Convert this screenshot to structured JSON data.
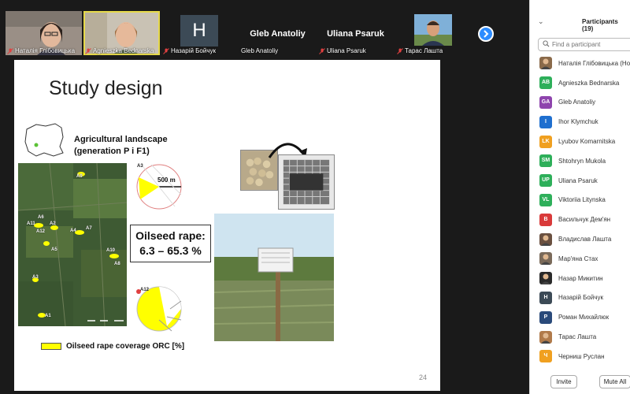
{
  "video_strip": {
    "tiles": [
      {
        "name": "Наталія Глібовицька",
        "muted": true
      },
      {
        "name": "Agnieszka Bednarska",
        "muted": true
      },
      {
        "name": "Назарій Бойчук",
        "muted": true,
        "initial": "H"
      },
      {
        "name": "Gleb Anatoliy",
        "muted": false,
        "label": "Gleb Anatoliy"
      },
      {
        "name": "Uliana Psaruk",
        "muted": true,
        "label": "Uliana Psaruk"
      },
      {
        "name": "Тарас Лашта",
        "muted": true
      }
    ]
  },
  "slide": {
    "title": "Study design",
    "landscape_label_line1": "Agricultural landscape",
    "landscape_label_line2": "(generation P i F1)",
    "oilseed_line1": "Oilseed rape:",
    "oilseed_line2": "6.3 – 65.3 %",
    "scale": "500 m",
    "legend": "Oilseed rape coverage ORC [%]",
    "page_number": "24",
    "site_labels": [
      "A9",
      "A3",
      "A6",
      "A11",
      "A12",
      "A2",
      "A4",
      "A7",
      "A5",
      "A10",
      "A8",
      "A3",
      "A1",
      "A12"
    ],
    "colors": {
      "oilseed": "#ffff00",
      "map_dark": "#3e5a33"
    }
  },
  "participants": {
    "title": "Participants (19)",
    "search_placeholder": "Find a participant",
    "list": [
      {
        "initials": "",
        "name": "Наталія Глібовицька (Host",
        "color": "#8a6a4a",
        "photo": true
      },
      {
        "initials": "AB",
        "name": "Agnieszka Bednarska",
        "color": "#2eaf5a"
      },
      {
        "initials": "GA",
        "name": "Gleb Anatoliy",
        "color": "#8e44ad"
      },
      {
        "initials": "I",
        "name": "Ihor Klymchuk",
        "color": "#1f6fcf"
      },
      {
        "initials": "LK",
        "name": "Lyubov Komarnitska",
        "color": "#f0a020"
      },
      {
        "initials": "SM",
        "name": "Shtohryn Mukola",
        "color": "#2eaf5a"
      },
      {
        "initials": "UP",
        "name": "Uliana Psaruk",
        "color": "#2eaf5a"
      },
      {
        "initials": "VL",
        "name": "Viktoriia Litynska",
        "color": "#2eaf5a"
      },
      {
        "initials": "В",
        "name": "Васильчук Дем'ян",
        "color": "#d93a3a"
      },
      {
        "initials": "",
        "name": "Владислав Лашта",
        "color": "#6a5040",
        "photo": true
      },
      {
        "initials": "",
        "name": "Мар'яна Стах",
        "color": "#7a6a5a",
        "photo": true
      },
      {
        "initials": "",
        "name": "Назар Микитин",
        "color": "#2a2a2a",
        "photo": true
      },
      {
        "initials": "H",
        "name": "Назарій Бойчук",
        "color": "#3c4a56"
      },
      {
        "initials": "Р",
        "name": "Роман Михайлюк",
        "color": "#2a4a7a"
      },
      {
        "initials": "",
        "name": "Тарас Лашта",
        "color": "#b07a4a",
        "photo": true
      },
      {
        "initials": "Ч",
        "name": "Черниш Руслан",
        "color": "#f0a020"
      }
    ],
    "invite_label": "Invite",
    "mute_all_label": "Mute All"
  }
}
